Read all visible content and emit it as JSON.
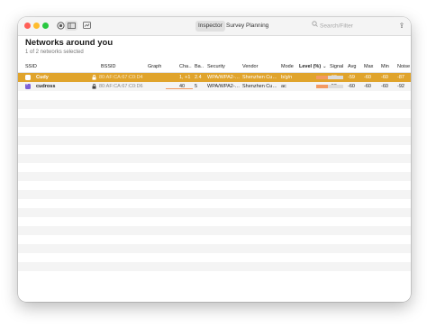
{
  "toolbar": {
    "tabs": [
      "Inspector",
      "Survey",
      "Planning"
    ],
    "active_tab": 0,
    "search_placeholder": "Search/Filter",
    "share_glyph": "⇪",
    "traffic_colors": [
      "#ff5f57",
      "#febc2e",
      "#28c840"
    ]
  },
  "header": {
    "title": "Networks around you",
    "subtitle": "1 of 2 networks selected"
  },
  "table": {
    "columns": [
      "SSID",
      "BSSID",
      "Graph",
      "Cha…",
      "Ba…",
      "Security",
      "Vendor",
      "Mode",
      "Level (%)",
      "⌄",
      "Signal",
      "Avg",
      "Max",
      "Min",
      "Noise"
    ],
    "rows": [
      {
        "checked": false,
        "selected": true,
        "ssid": "Cudy",
        "bssid": "80:AF:CA:67:C0:D4",
        "channel": "1, +1",
        "band": "2.4",
        "security": "WPA/WPA2-…",
        "vendor": "Shenzhen Cu…",
        "mode": "b/g/n",
        "level": 0.42,
        "signal": "-60",
        "avg": "-59",
        "max": "-60",
        "min": "-60",
        "noise": "-87"
      },
      {
        "checked": true,
        "selected": false,
        "ssid": "cudross",
        "bssid": "80:AF:CA:67:C0:D6",
        "channel": "40",
        "band": "5",
        "security": "WPA/WPA2-…",
        "vendor": "Shenzhen Cu…",
        "mode": "ac",
        "level": 0.42,
        "signal": "-59",
        "avg": "-60",
        "max": "-60",
        "min": "-60",
        "noise": "-92"
      }
    ]
  }
}
